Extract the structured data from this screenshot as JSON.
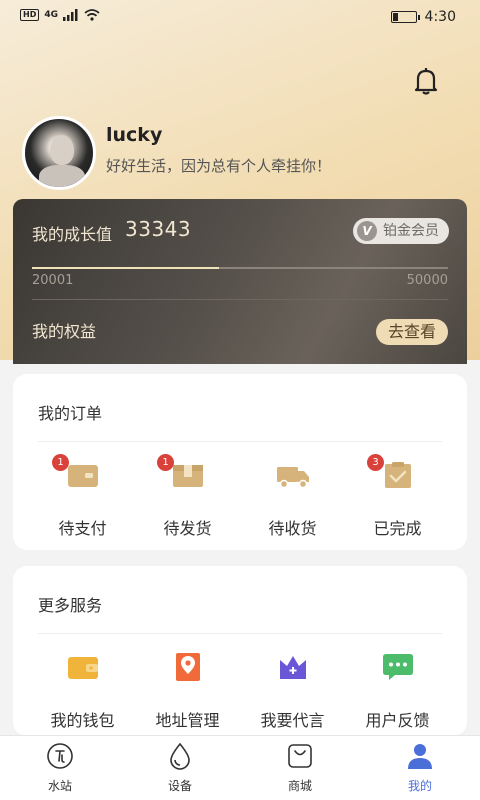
{
  "status_bar": {
    "network_badge": "HD",
    "network_type": "4G",
    "time": "4:30",
    "icons": [
      "hd-icon",
      "signal-icon",
      "wifi-icon",
      "battery-icon"
    ]
  },
  "header": {
    "bell_icon": "bell-icon"
  },
  "profile": {
    "username": "lucky",
    "motto": "好好生活，因为总有个人牵挂你！"
  },
  "growth": {
    "label": "我的成长值",
    "value": "33343",
    "tier": "铂金会员",
    "tier_letter": "V",
    "range_min": "20001",
    "range_max": "50000",
    "progress_fraction": 0.45,
    "benefits_label": "我的权益",
    "view_button": "去查看"
  },
  "orders": {
    "title": "我的订单",
    "items": [
      {
        "label": "待支付",
        "icon": "wallet-card-icon",
        "badge": "1"
      },
      {
        "label": "待发货",
        "icon": "package-box-icon",
        "badge": "1"
      },
      {
        "label": "待收货",
        "icon": "delivery-truck-icon",
        "badge": ""
      },
      {
        "label": "已完成",
        "icon": "clipboard-check-icon",
        "badge": "3"
      }
    ]
  },
  "services": {
    "title": "更多服务",
    "items": [
      {
        "label": "我的钱包",
        "icon": "wallet-icon",
        "color": "#f0b43a"
      },
      {
        "label": "地址管理",
        "icon": "location-book-icon",
        "color": "#f06a3a"
      },
      {
        "label": "我要代言",
        "icon": "crown-icon",
        "color": "#6a57d8"
      },
      {
        "label": "用户反馈",
        "icon": "chat-bubble-icon",
        "color": "#4cbb6a"
      }
    ]
  },
  "tabbar": {
    "items": [
      {
        "label": "水站",
        "icon": "water-station-icon"
      },
      {
        "label": "设备",
        "icon": "water-drop-icon"
      },
      {
        "label": "商城",
        "icon": "shopping-bag-icon"
      },
      {
        "label": "我的",
        "icon": "person-icon"
      }
    ],
    "active_index": 3,
    "active_color": "#4b6fd8"
  },
  "colors": {
    "gold": "#d6b37a",
    "badge_red": "#d9413b",
    "card_dark": "#4b4640"
  }
}
